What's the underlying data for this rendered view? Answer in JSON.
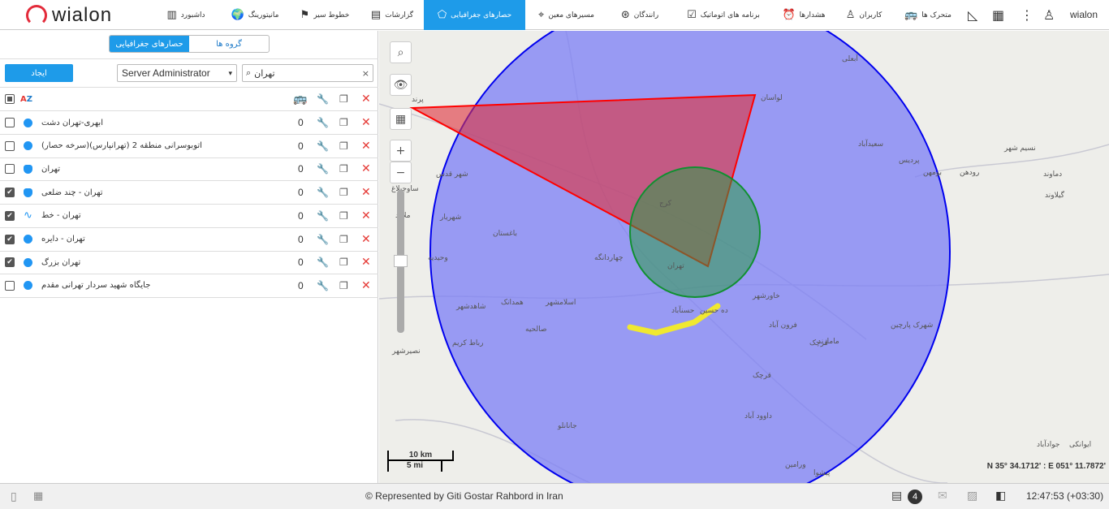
{
  "header": {
    "logo": "wialon",
    "user": "wialon",
    "nav": [
      {
        "label": "داشبورد",
        "icon": "bar-chart-icon"
      },
      {
        "label": "مانیتورینگ",
        "icon": "globe-icon"
      },
      {
        "label": "خطوط سیر",
        "icon": "flag-icon"
      },
      {
        "label": "گزارشات",
        "icon": "report-icon"
      },
      {
        "label": "حصارهای جغرافیایی",
        "icon": "geofence-icon",
        "active": true
      },
      {
        "label": "مسیرهای معین",
        "icon": "route-icon"
      },
      {
        "label": "رانندگان",
        "icon": "steering-wheel-icon"
      },
      {
        "label": "برنامه های اتوماتیک",
        "icon": "clipboard-check-icon"
      },
      {
        "label": "هشدارها",
        "icon": "alarm-clock-icon"
      },
      {
        "label": "کاربران",
        "icon": "user-icon"
      },
      {
        "label": "متحرک ها",
        "icon": "truck-icon"
      }
    ]
  },
  "panel": {
    "tabs": {
      "geofences": "حصارهای جغرافیایی",
      "groups": "گروه ها"
    },
    "create": "ایجاد",
    "owner": "Server Administrator",
    "search": "تهران",
    "rows": [
      {
        "name": "ابهری-تهران دشت",
        "count": "0",
        "checked": false,
        "shape": "circle"
      },
      {
        "name": "اتوبوسرانی منطقه 2 (تهرانپارس)(سرخه حصار)",
        "count": "0",
        "checked": false,
        "shape": "circle"
      },
      {
        "name": "تهران",
        "count": "0",
        "checked": false,
        "shape": "polygon"
      },
      {
        "name": "تهران - چند ضلعی",
        "count": "0",
        "checked": true,
        "shape": "polygon"
      },
      {
        "name": "تهران - خط",
        "count": "0",
        "checked": true,
        "shape": "line"
      },
      {
        "name": "تهران - دایره",
        "count": "0",
        "checked": true,
        "shape": "circle"
      },
      {
        "name": "تهران بزرگ",
        "count": "0",
        "checked": true,
        "shape": "circle"
      },
      {
        "name": "جایگاه شهید سردار تهرانی مقدم",
        "count": "0",
        "checked": false,
        "shape": "circle"
      }
    ]
  },
  "map": {
    "scale_km": "10 km",
    "scale_mi": "5 mi",
    "coords": "N 35° 34.1712' : E 051° 11.7872'",
    "labels": [
      "لواسان",
      "سعیدآباد",
      "پردیس",
      "بومهن",
      "رودهن",
      "دماوند",
      "گیلاوند",
      "شهر قدس",
      "شهریار",
      "ملارد",
      "باغستان",
      "وحیدیه",
      "ساوجبلاغ",
      "اسلامشهر",
      "صالحیه",
      "قرچک",
      "ورامین",
      "پیشوا",
      "جوادآباد",
      "ایوانکی",
      "خاورشهر",
      "قرچک",
      "مامازند",
      "شهرک پارچین",
      "فرون آباد",
      "داوود آباد",
      "جانانلو",
      "رباط کریم",
      "چهاردانگه",
      "شاهدشهر",
      "همدانک",
      "نصیرشهر",
      "پرند",
      "کرج",
      "تهران",
      "حسنآباد",
      "ده حسین",
      "نسیم شهر",
      "آبعلی"
    ],
    "colors": {
      "big_circle": "#7b7ef5",
      "triangle": "#e0303a",
      "small_circle": "#2e9a4a",
      "line": "#f0e830"
    }
  },
  "footer": {
    "copyright": "© Represented by Giti Gostar Rahbord in Iran",
    "notifications": "4",
    "time": "12:47:53 (+03:30)"
  }
}
